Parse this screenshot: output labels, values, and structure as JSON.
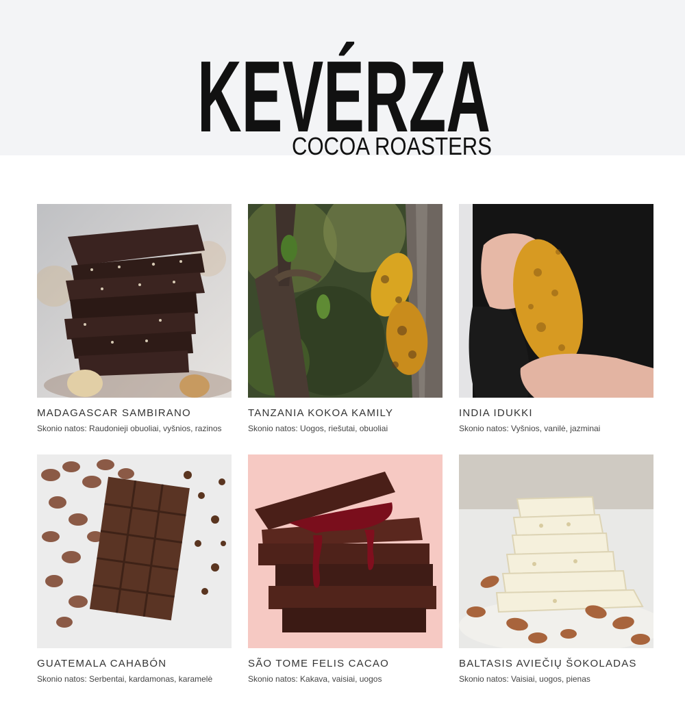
{
  "brand": {
    "name": "KEVÉRZA",
    "tagline": "COCOA ROASTERS"
  },
  "products": [
    {
      "title": "MADAGASCAR SAMBIRANO",
      "notes": "Skonio natos: Raudonieji obuoliai, vyšnios, razinos",
      "image": "dark-chocolate-stack-photo"
    },
    {
      "title": "TANZANIA KOKOA KAMILY",
      "notes": "Skonio natos: Uogos, riešutai, obuoliai",
      "image": "cacao-pods-tree-photo"
    },
    {
      "title": "INDIA IDUKKI",
      "notes": "Skonio natos: Vyšnios, vanilė, jazminai",
      "image": "hands-holding-cacao-pod-photo"
    },
    {
      "title": "GUATEMALA CAHABÓN",
      "notes": "Skonio natos: Serbentai, kardamonas, karamelė",
      "image": "chocolate-bar-cocoa-beans-photo"
    },
    {
      "title": "SÃO TOME FELIS CACAO",
      "notes": "Skonio natos: Kakava, vaisiai, uogos",
      "image": "chocolate-stack-raspberry-photo"
    },
    {
      "title": "BALTASIS AVIEČIŲ ŠOKOLADAS",
      "notes": "Skonio natos: Vaisiai, uogos, pienas",
      "image": "white-chocolate-almonds-photo"
    }
  ],
  "colors": {
    "header_bg": "#f3f4f6",
    "logo": "#111111",
    "title_text": "#333333",
    "notes_text": "#444444"
  }
}
